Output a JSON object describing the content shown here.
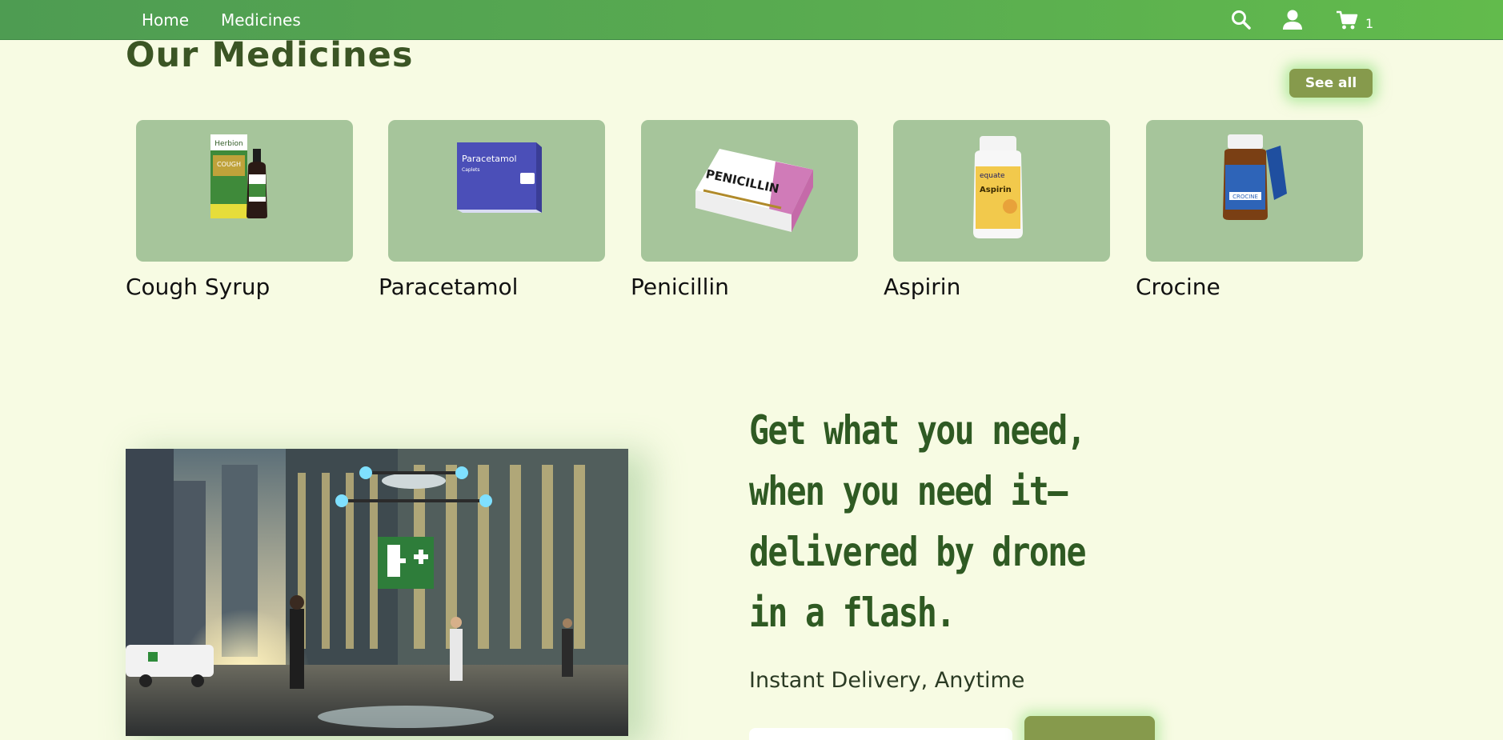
{
  "nav": {
    "links": [
      "Home",
      "Medicines"
    ],
    "icons": [
      "search-icon",
      "user-icon",
      "cart-icon"
    ],
    "cart_count": "1"
  },
  "medicines_section": {
    "title": "Our Medicines",
    "see_all_label": "See all",
    "products": [
      {
        "name": "Cough Syrup",
        "image": "cough-syrup-image"
      },
      {
        "name": "Paracetamol",
        "image": "paracetamol-image"
      },
      {
        "name": "Penicillin",
        "image": "penicillin-image"
      },
      {
        "name": "Aspirin",
        "image": "aspirin-image"
      },
      {
        "name": "Crocine",
        "image": "crocine-image"
      }
    ]
  },
  "hero": {
    "heading": "Get what you need, when you need it—delivered by drone in a flash.",
    "subheading": "Instant Delivery, Anytime",
    "image_alt": "drone delivery image"
  },
  "colors": {
    "nav_green": "#5aad50",
    "page_bg": "#f7fbe3",
    "card_bg": "#a6c59b",
    "button_olive": "#869a4c",
    "heading_green": "#2f5a23"
  }
}
